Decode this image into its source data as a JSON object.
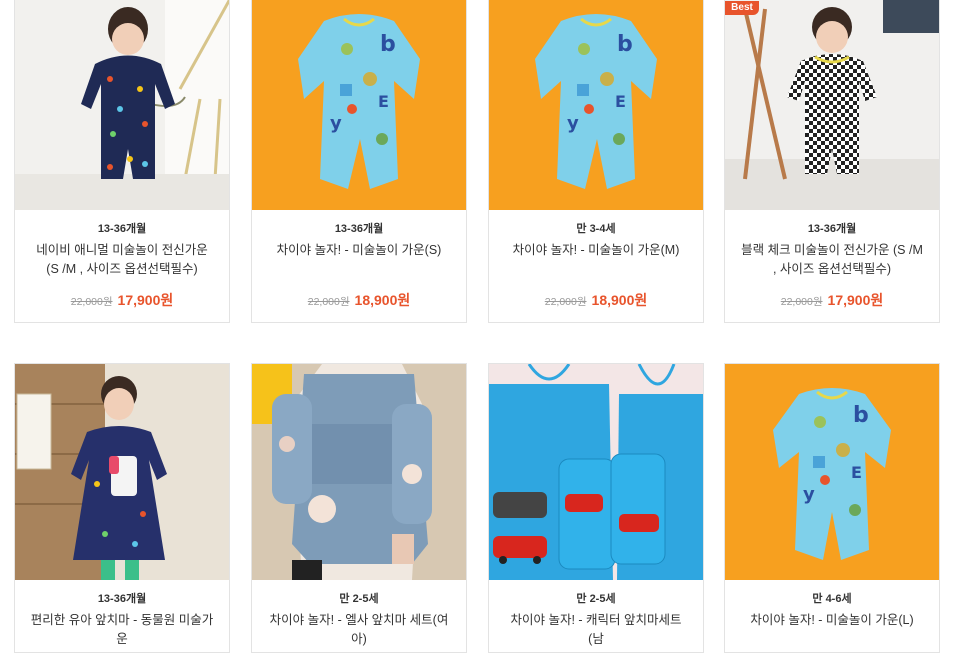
{
  "colors": {
    "accent": "#e8542c",
    "orange_bg": "#f7a01f",
    "muted": "#9a9a9a"
  },
  "products": [
    {
      "age": "13-36개월",
      "name": "네이비 애니멀 미술놀이 전신가운 (S /M , 사이즈 옵션선택필수)",
      "original_price": "22,000원",
      "sale_price": "17,900원"
    },
    {
      "age": "13-36개월",
      "name": "차이야 놀자! - 미술놀이 가운(S)",
      "original_price": "22,000원",
      "sale_price": "18,900원"
    },
    {
      "age": "만 3-4세",
      "name": "차이야 놀자! - 미술놀이 가운(M)",
      "original_price": "22,000원",
      "sale_price": "18,900원"
    },
    {
      "age": "13-36개월",
      "name": "블랙 체크 미술놀이 전신가운 (S /M , 사이즈 옵션선택필수)",
      "original_price": "22,000원",
      "sale_price": "17,900원",
      "badge": "Best"
    },
    {
      "age": "13-36개월",
      "name": "편리한 유아 앞치마 - 동물원 미술가운"
    },
    {
      "age": "만 2-5세",
      "name": "차이야 놀자! - 엘사 앞치마 세트(여아)"
    },
    {
      "age": "만 2-5세",
      "name": "차이야 놀자! - 캐릭터 앞치마세트(남"
    },
    {
      "age": "만 4-6세",
      "name": "차이야 놀자! - 미술놀이 가운(L)"
    }
  ]
}
